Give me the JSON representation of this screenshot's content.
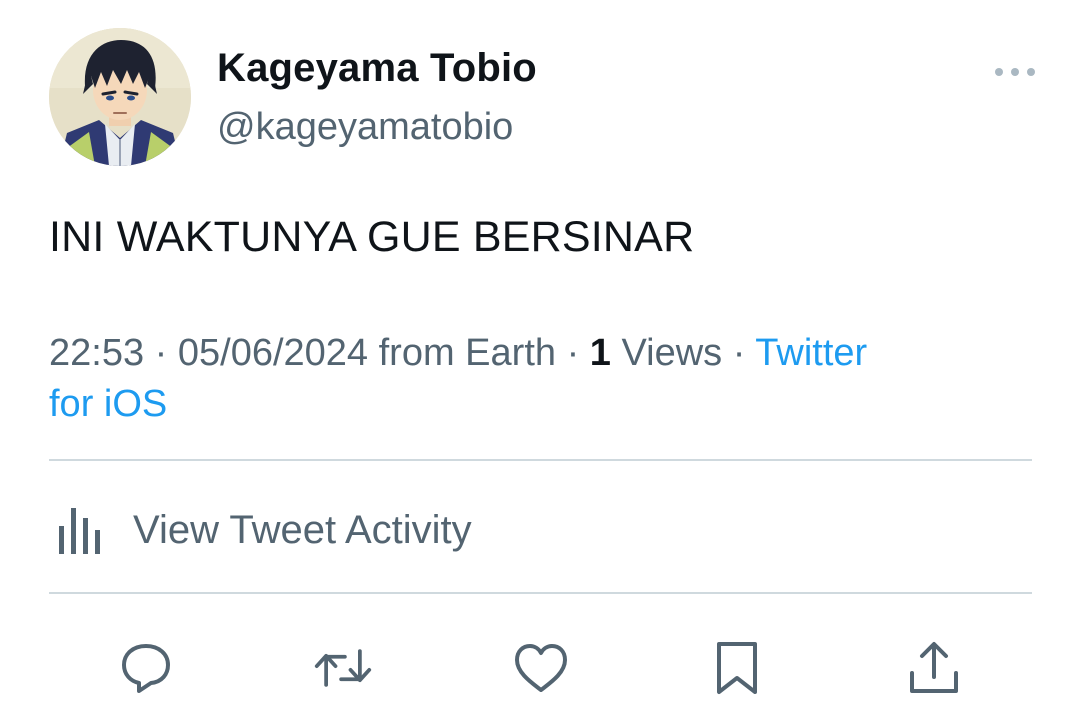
{
  "tweet": {
    "author": {
      "display_name": "Kageyama Tobio",
      "handle": "@kageyamatobio",
      "avatar_icon": "avatar-image"
    },
    "text": "INI WAKTUNYA GUE BERSINAR",
    "meta": {
      "time": "22:53",
      "separator": "·",
      "date": "05/06/2024",
      "location": "from Earth",
      "views_count": "1",
      "views_label": "Views",
      "source_line1": "Twitter",
      "source_line2": "for iOS"
    },
    "activity": {
      "label": "View Tweet Activity",
      "icon": "bar-chart-icon"
    },
    "actions": [
      {
        "name": "reply",
        "icon": "reply-icon"
      },
      {
        "name": "retweet",
        "icon": "retweet-icon"
      },
      {
        "name": "like",
        "icon": "heart-icon"
      },
      {
        "name": "bookmark",
        "icon": "bookmark-icon"
      },
      {
        "name": "share",
        "icon": "share-icon"
      }
    ],
    "more_icon": "more-icon"
  },
  "colors": {
    "text_primary": "#0f1419",
    "text_secondary": "#536471",
    "link": "#1d9bf0",
    "divider": "#cfd9de"
  }
}
